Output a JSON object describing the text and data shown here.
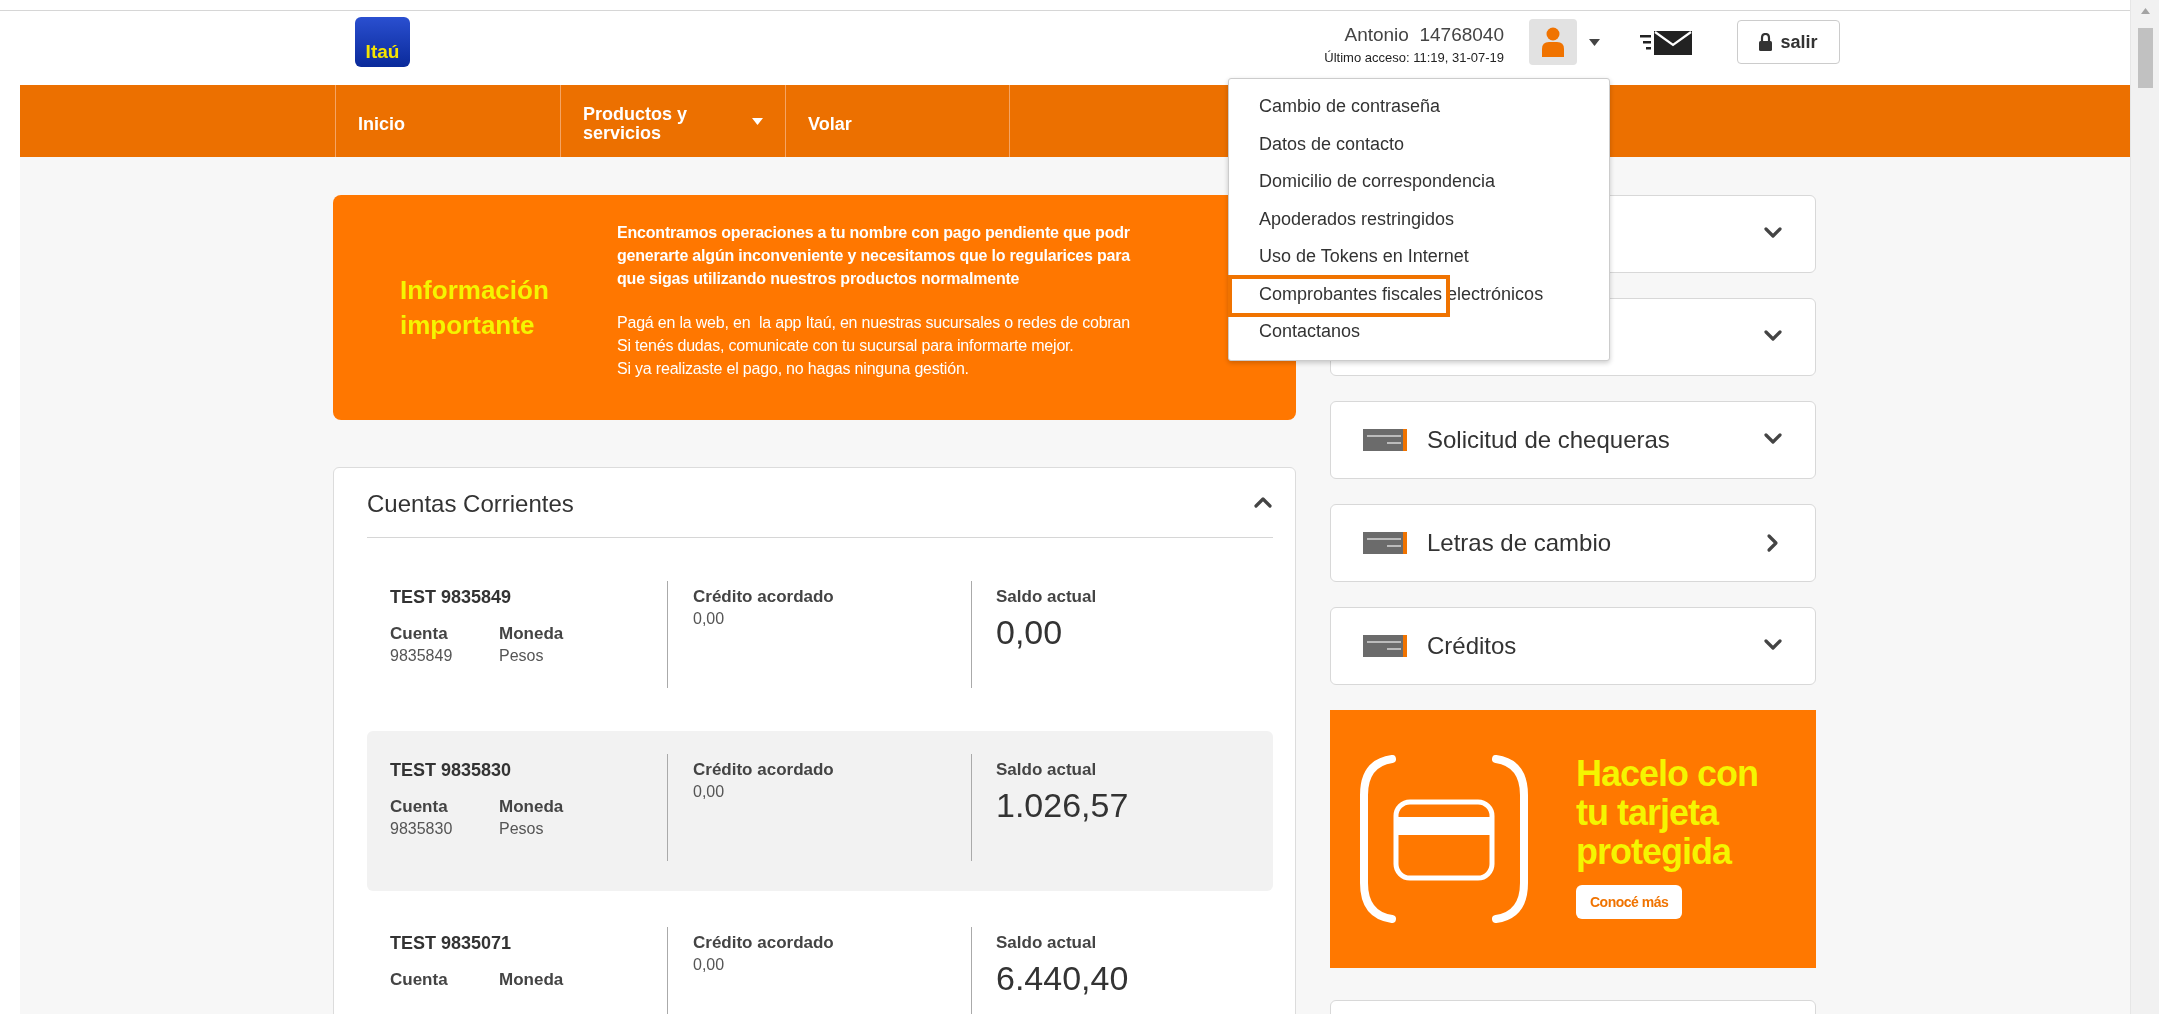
{
  "header": {
    "logo": "Itaú",
    "user_name": "Antonio  14768040",
    "last_access": "Último acceso: 11:19, 31-07-19",
    "logout": "salir"
  },
  "nav": [
    {
      "label": "Inicio",
      "dropdown": false
    },
    {
      "label": "Productos y servicios",
      "dropdown": true
    },
    {
      "label": "Volar",
      "dropdown": false
    }
  ],
  "user_menu": [
    {
      "label": "Cambio de contraseña",
      "marked": false
    },
    {
      "label": "Datos de contacto",
      "marked": false
    },
    {
      "label": "Domicilio de correspondencia",
      "marked": false
    },
    {
      "label": "Apoderados restringidos",
      "marked": false
    },
    {
      "label": "Uso de Tokens en Internet",
      "marked": false
    },
    {
      "label": "Comprobantes fiscales electrónicos",
      "marked": true
    },
    {
      "label": "Contactanos",
      "marked": false
    }
  ],
  "notice": {
    "title": "Información importante",
    "paragraphs": [
      {
        "bold": true,
        "lines": [
          "Encontramos operaciones a tu nombre con pago pendiente que podr",
          "generarte algún inconveniente y necesitamos que lo regularices para",
          "que sigas utilizando nuestros productos normalmente"
        ]
      },
      {
        "bold": false,
        "lines": [
          "Pagá en la web, en  la app Itaú, en nuestras sucursales o redes de cobran",
          "Si tenés dudas, comunicate con tu sucursal para informarte mejor.",
          "Si ya realizaste el pago, no hagas ninguna gestión."
        ]
      }
    ]
  },
  "accounts": {
    "title": "Cuentas Corrientes",
    "expanded": true,
    "rows": [
      {
        "name": "TEST 9835849",
        "highlighted": false,
        "account_label": "Cuenta",
        "account": "9835849",
        "currency_label": "Moneda",
        "currency": "Pesos",
        "credit_label": "Crédito acordado",
        "credit": "0,00",
        "balance_label": "Saldo actual",
        "balance": "0,00"
      },
      {
        "name": "TEST 9835830",
        "highlighted": true,
        "account_label": "Cuenta",
        "account": "9835830",
        "currency_label": "Moneda",
        "currency": "Pesos",
        "credit_label": "Crédito acordado",
        "credit": "0,00",
        "balance_label": "Saldo actual",
        "balance": "1.026,57"
      },
      {
        "name": "TEST 9835071",
        "highlighted": false,
        "account_label": "Cuenta",
        "currency_label": "Moneda",
        "credit_label": "Crédito acordado",
        "credit": "0,00",
        "balance_label": "Saldo actual",
        "balance": "6.440,40"
      }
    ]
  },
  "side_cards": [
    {
      "expandable": true
    },
    {
      "expandable": true
    },
    {
      "title": "Solicitud de chequeras",
      "expandable": true
    },
    {
      "title": "Letras de cambio",
      "expandable": false
    },
    {
      "title": "Créditos",
      "expandable": true
    }
  ],
  "promo": {
    "headline": [
      "Hacelo con",
      "tu tarjeta",
      "protegida"
    ],
    "button": "Conocé más"
  },
  "lower_card": true
}
